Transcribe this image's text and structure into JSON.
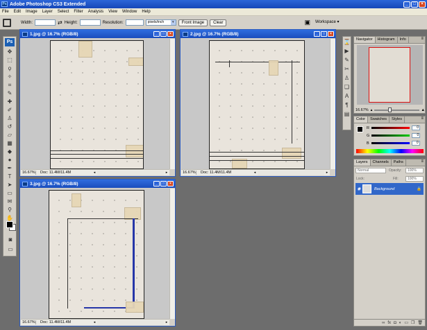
{
  "app": {
    "title": "Adobe Photoshop CS3 Extended",
    "logo": "Ps"
  },
  "window_buttons": {
    "minimize": "_",
    "maximize": "□",
    "close": "×"
  },
  "menu": [
    "File",
    "Edit",
    "Image",
    "Layer",
    "Select",
    "Filter",
    "Analysis",
    "View",
    "Window",
    "Help"
  ],
  "options_bar": {
    "width_label": "Width:",
    "height_label": "Height:",
    "resolution_label": "Resolution:",
    "units": "pixels/inch",
    "front_image": "Front Image",
    "clear": "Clear",
    "workspace": "Workspace ▾"
  },
  "documents": [
    {
      "title": "1.jpg @ 16.7% (RGB/8)",
      "zoom": "16.67%",
      "doc_info": "Doc: 11.4M/11.4M"
    },
    {
      "title": "2.jpg @ 16.7% (RGB/8)",
      "zoom": "16.67%",
      "doc_info": "Doc: 11.4M/11.4M"
    },
    {
      "title": "3.jpg @ 16.7% (RGB/8)",
      "zoom": "16.67%",
      "doc_info": "Doc: 11.4M/11.4M"
    }
  ],
  "navigator": {
    "tabs": [
      "Navigator",
      "Histogram",
      "Info"
    ],
    "zoom": "16.67%"
  },
  "color_panel": {
    "tabs": [
      "Color",
      "Swatches",
      "Styles"
    ],
    "channels": [
      {
        "label": "R",
        "value": "0",
        "color": "#d01010"
      },
      {
        "label": "G",
        "value": "0",
        "color": "#10a010"
      },
      {
        "label": "B",
        "value": "0",
        "color": "#1020c0"
      }
    ]
  },
  "layers_panel": {
    "tabs": [
      "Layers",
      "Channels",
      "Paths"
    ],
    "blend_mode": "Normal",
    "opacity_label": "Opacity:",
    "opacity": "100%",
    "lock_label": "Lock:",
    "fill_label": "Fill:",
    "fill": "100%",
    "layer_name": "Background"
  },
  "colors": {
    "accent": "#2f6ddf",
    "chrome": "#d4d0c8",
    "workspace": "#6d6d6d"
  }
}
